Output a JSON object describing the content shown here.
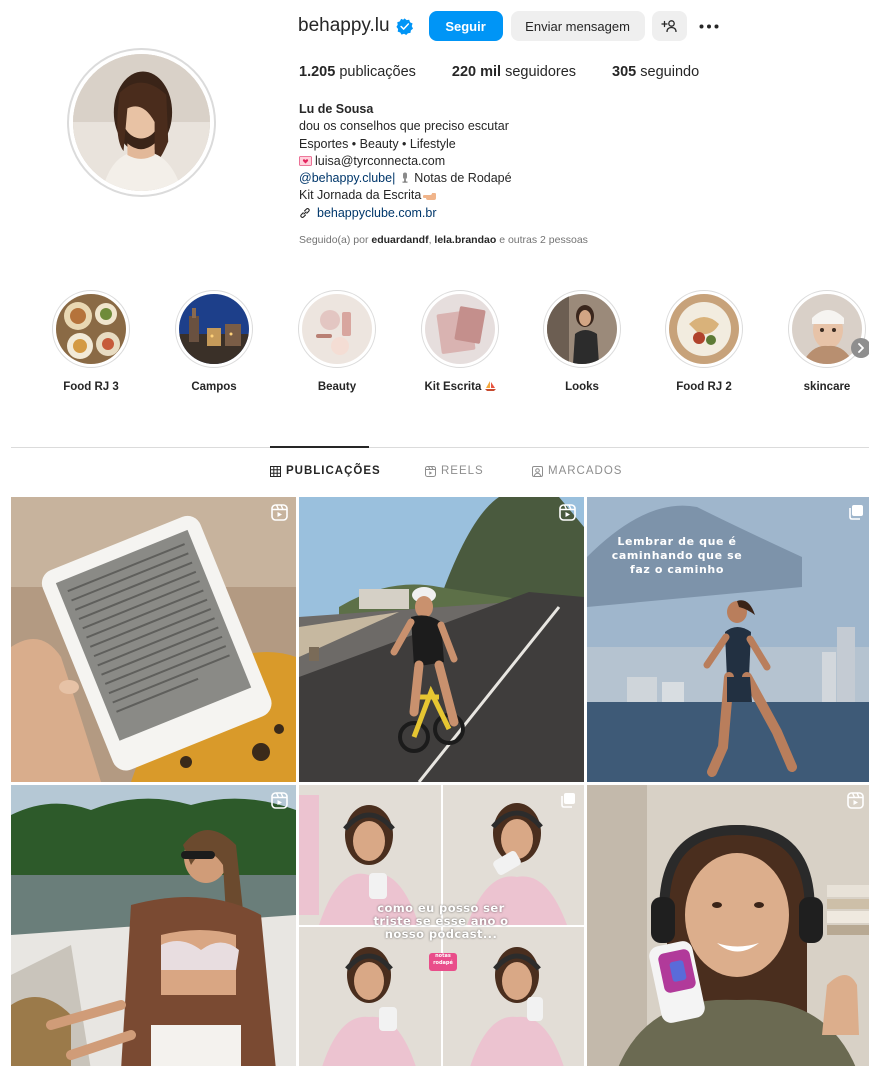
{
  "profile": {
    "username": "behappy.lu",
    "follow_label": "Seguir",
    "message_label": "Enviar mensagem",
    "stats": {
      "posts_count": "1.205",
      "posts_label": "publicações",
      "followers_count": "220 mil",
      "followers_label": "seguidores",
      "following_count": "305",
      "following_label": "seguindo"
    },
    "bio": {
      "name": "Lu de Sousa",
      "line1": "dou os conselhos que preciso escutar",
      "line2": "Esportes • Beauty • Lifestyle",
      "email": "luisa@tyrconnecta.com",
      "handle_link": "@behappy.clube|",
      "handle_suffix": "Notas de Rodapé",
      "kit_line": "Kit Jornada da Escrita",
      "website": "behappyclube.com.br"
    },
    "followed_by": {
      "prefix": "Seguido(a) por",
      "user1": "eduardandf",
      "separator": ",",
      "user2": "lela.brandao",
      "suffix": "e outras 2 pessoas"
    }
  },
  "highlights": [
    {
      "label": "Food RJ 3"
    },
    {
      "label": "Campos"
    },
    {
      "label": "Beauty"
    },
    {
      "label": "Kit Escrita",
      "emoji": "⛵"
    },
    {
      "label": "Looks"
    },
    {
      "label": "Food RJ 2"
    },
    {
      "label": "skincare"
    }
  ],
  "tabs": [
    {
      "label": "PUBLICAÇÕES",
      "icon": "grid-icon",
      "active": true
    },
    {
      "label": "REELS",
      "icon": "reels-icon",
      "active": false
    },
    {
      "label": "MARCADOS",
      "icon": "tagged-icon",
      "active": false
    }
  ],
  "posts": [
    {
      "type": "reel",
      "overlay_text": ""
    },
    {
      "type": "reel",
      "overlay_text": ""
    },
    {
      "type": "carousel",
      "overlay_line1": "Lembrar de que é",
      "overlay_line2": "caminhando que se",
      "overlay_line3": "faz o caminho"
    },
    {
      "type": "reel",
      "overlay_text": ""
    },
    {
      "type": "carousel",
      "overlay_line1": "como eu posso ser",
      "overlay_line2": "triste se esse ano o",
      "overlay_line3": "nosso podcast...",
      "sticker1": "notas",
      "sticker2": "rodapé"
    },
    {
      "type": "reel",
      "overlay_text": ""
    }
  ],
  "colors": {
    "primary": "#0095f6",
    "verified": "#0095f6",
    "link": "#00376b",
    "muted": "#737373"
  }
}
